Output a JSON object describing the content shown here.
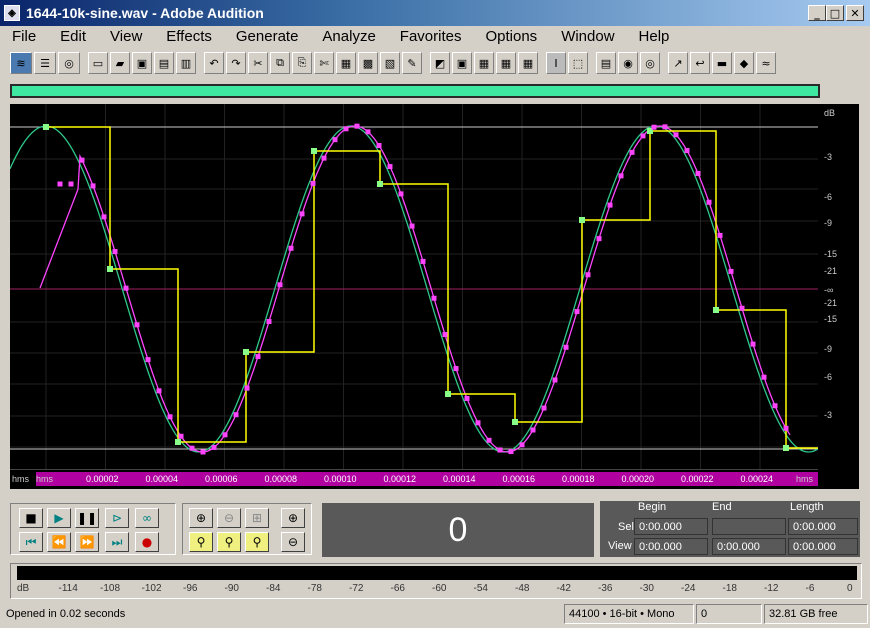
{
  "window": {
    "title": "1644-10k-sine.wav - Adobe Audition"
  },
  "menu": [
    "File",
    "Edit",
    "View",
    "Effects",
    "Generate",
    "Analyze",
    "Favorites",
    "Options",
    "Window",
    "Help"
  ],
  "ruler": {
    "left_unit": "hms",
    "right_unit": "hms",
    "ticks": [
      "0.00002",
      "0.00004",
      "0.00006",
      "0.00008",
      "0.00010",
      "0.00012",
      "0.00014",
      "0.00016",
      "0.00018",
      "0.00020",
      "0.00022",
      "0.00024"
    ]
  },
  "db_scale": [
    "dB",
    "-3",
    "-6",
    "-9",
    "-15",
    "-21",
    "-∞",
    "-21",
    "-15",
    "-9",
    "-6",
    "-3"
  ],
  "time_display": "0",
  "selection": {
    "begin_header": "Begin",
    "end_header": "End",
    "length_header": "Length",
    "sel_label": "Sel",
    "view_label": "View",
    "sel_begin": "0:00.000",
    "sel_end": "",
    "sel_length": "0:00.000",
    "view_begin": "0:00.000",
    "view_end": "0:00.000",
    "view_length": "0:00.000"
  },
  "level_meter": {
    "labels": [
      "dB",
      "-114",
      "-108",
      "-102",
      "-96",
      "-90",
      "-84",
      "-78",
      "-72",
      "-66",
      "-60",
      "-54",
      "-48",
      "-42",
      "-36",
      "-30",
      "-24",
      "-18",
      "-12",
      "-6",
      "0"
    ]
  },
  "status": {
    "message": "Opened in 0.02 seconds",
    "format": "44100 • 16-bit • Mono",
    "size": "0",
    "free": "32.81 GB free"
  },
  "colors": {
    "stair": "#ffff00",
    "sine": "#2ec88a",
    "sample_dots": "#ff44ff",
    "ruler": "#b000a0"
  }
}
